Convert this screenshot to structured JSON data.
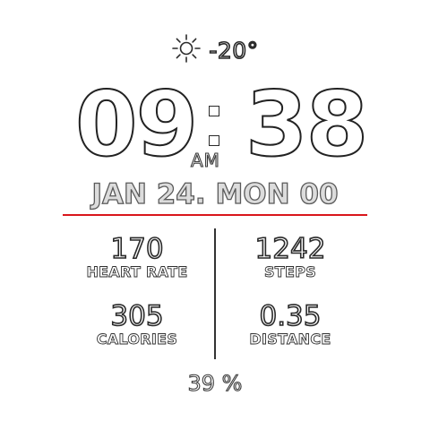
{
  "weather": {
    "icon": "sun-icon",
    "temperature": "-20°"
  },
  "time": {
    "hour": "09",
    "minute": "38",
    "ampm": "AM"
  },
  "date": {
    "text": "JAN 24. MON 00"
  },
  "stats": {
    "heart_rate": {
      "value": "170",
      "label": "HEART RATE"
    },
    "steps": {
      "value": "1242",
      "label": "STEPS"
    },
    "calories": {
      "value": "305",
      "label": "CALORIES"
    },
    "distance": {
      "value": "0.35",
      "label": "DISTANCE"
    }
  },
  "battery": {
    "text": "39 %"
  },
  "colors": {
    "accent_line": "#d9161b",
    "background": "#ffffff",
    "outline": "#2a2a2a"
  }
}
